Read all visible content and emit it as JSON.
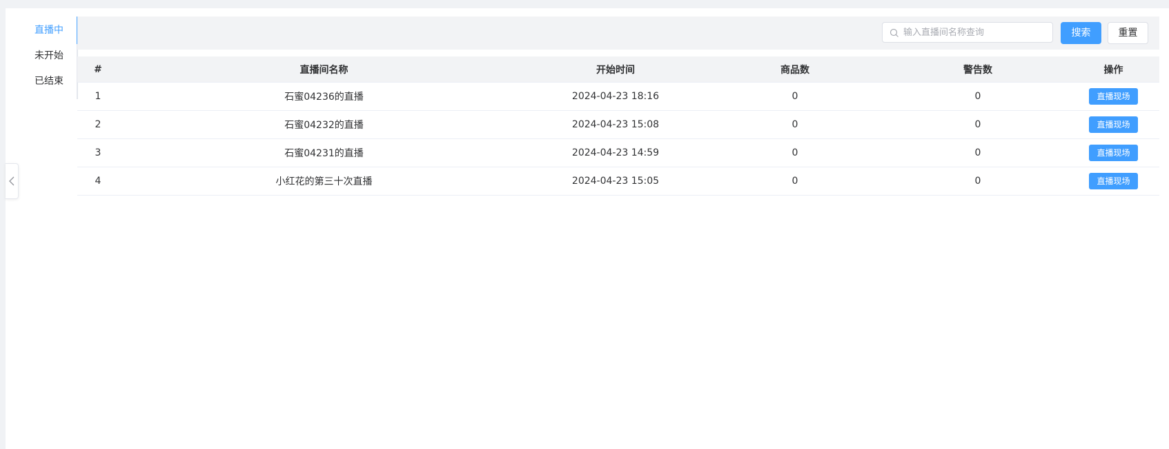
{
  "tabs": [
    {
      "label": "直播中",
      "active": true
    },
    {
      "label": "未开始",
      "active": false
    },
    {
      "label": "已结束",
      "active": false
    }
  ],
  "search": {
    "placeholder": "输入直播间名称查询",
    "search_label": "搜索",
    "reset_label": "重置"
  },
  "table": {
    "headers": [
      "#",
      "直播间名称",
      "开始时间",
      "商品数",
      "警告数",
      "操作"
    ],
    "rows": [
      {
        "index": "1",
        "name": "石蜜04236的直播",
        "start": "2024-04-23 18:16",
        "goods": "0",
        "warnings": "0",
        "action": "直播现场"
      },
      {
        "index": "2",
        "name": "石蜜04232的直播",
        "start": "2024-04-23 15:08",
        "goods": "0",
        "warnings": "0",
        "action": "直播现场"
      },
      {
        "index": "3",
        "name": "石蜜04231的直播",
        "start": "2024-04-23 14:59",
        "goods": "0",
        "warnings": "0",
        "action": "直播现场"
      },
      {
        "index": "4",
        "name": "小红花的第三十次直播",
        "start": "2024-04-23 15:05",
        "goods": "0",
        "warnings": "0",
        "action": "直播现场"
      }
    ]
  },
  "colors": {
    "accent": "#409eff",
    "header_bg": "#f2f3f5",
    "page_bg": "#f0f2f5"
  },
  "icons": {
    "search": "search-icon",
    "collapse": "chevron-left-icon"
  }
}
